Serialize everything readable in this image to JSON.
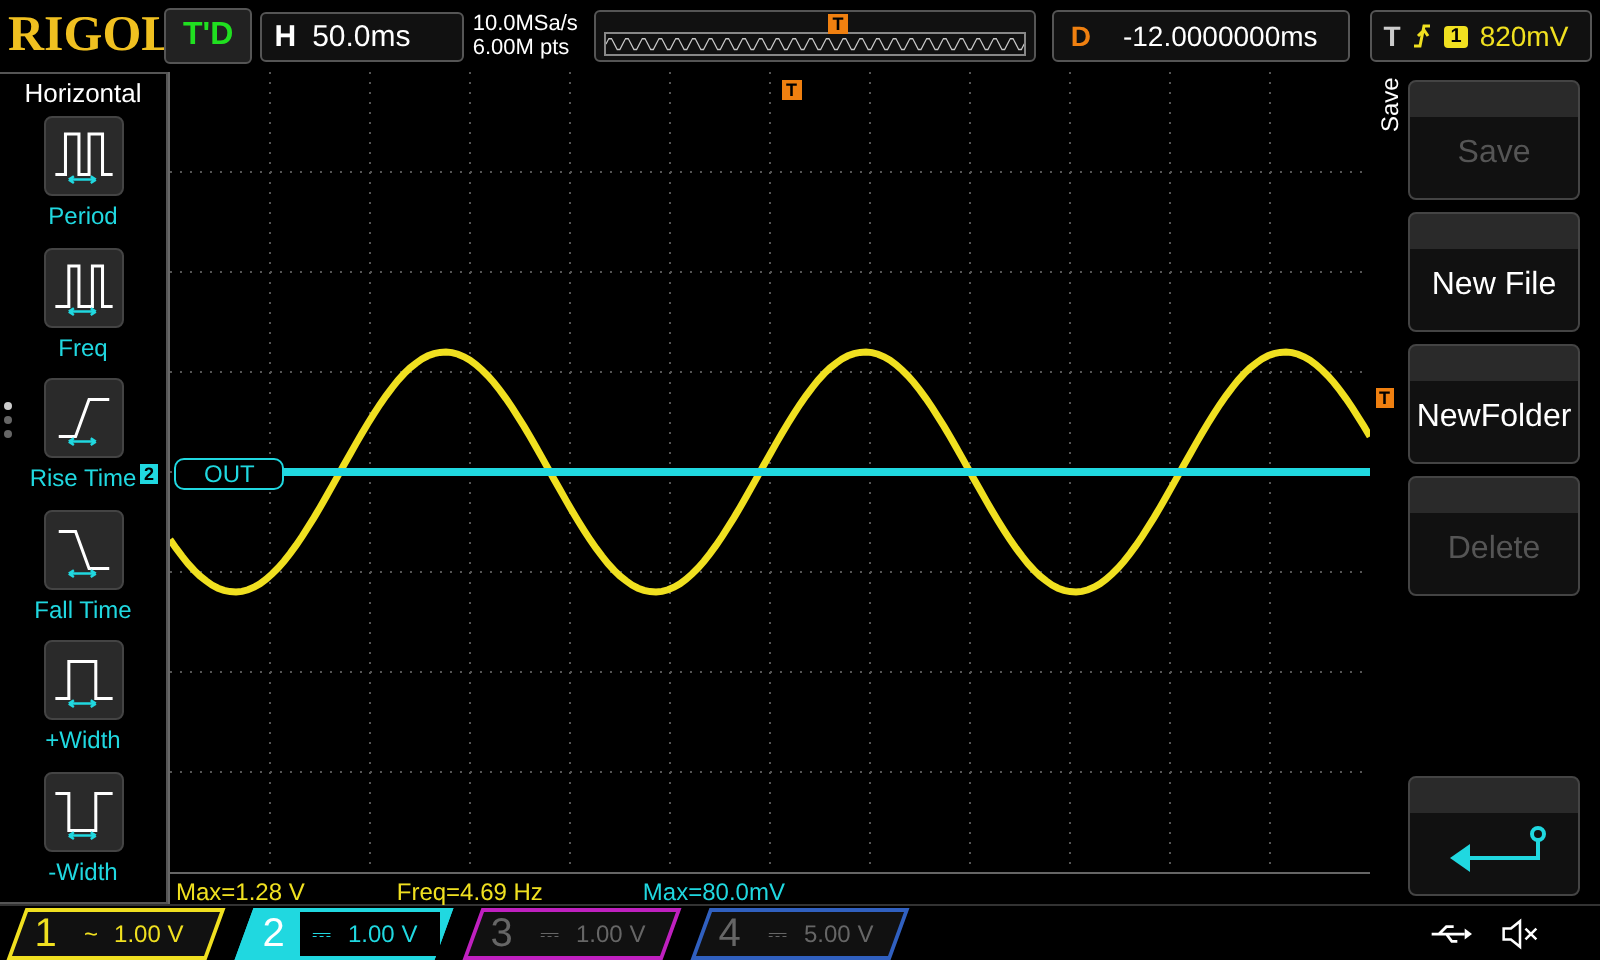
{
  "top_bar": {
    "logo": "RIGOL",
    "run_status": "T'D",
    "horizontal": {
      "label": "H",
      "timebase": "50.0ms",
      "sample_rate": "10.0MSa/s",
      "memory_depth": "6.00M pts",
      "trigger_marker": "T"
    },
    "delay": {
      "label": "D",
      "value": "-12.0000000ms"
    },
    "trigger": {
      "label": "T",
      "source": "1",
      "level": "820mV"
    }
  },
  "left_menu": {
    "title": "Horizontal",
    "items": [
      {
        "kind": "period",
        "label": "Period"
      },
      {
        "kind": "freq",
        "label": "Freq"
      },
      {
        "kind": "rise",
        "label": "Rise Time"
      },
      {
        "kind": "fall",
        "label": "Fall Time"
      },
      {
        "kind": "pwidth",
        "label": "+Width"
      },
      {
        "kind": "nwidth",
        "label": "-Width"
      }
    ]
  },
  "screen": {
    "trigger_position_marker": "T",
    "trigger_level_marker": "T",
    "channel_marker": "2",
    "channel_label": "OUT"
  },
  "right_menu": {
    "title": "Save",
    "buttons": [
      {
        "kind": "text",
        "label": "Save",
        "disabled": true
      },
      {
        "kind": "text",
        "label": "New File",
        "disabled": false
      },
      {
        "kind": "text",
        "label": "NewFolder",
        "disabled": false
      },
      {
        "kind": "text",
        "label": "Delete",
        "disabled": true
      },
      {
        "kind": "back"
      }
    ]
  },
  "measurements": [
    {
      "text": "Max=1.28 V",
      "color": "#f0e020"
    },
    {
      "text": "Freq=4.69 Hz",
      "color": "#f0e020"
    },
    {
      "text": "Max=80.0mV",
      "color": "#20d8e0"
    }
  ],
  "channels": [
    {
      "number": "1",
      "coupling": "~",
      "scale": "1.00 V",
      "on": true,
      "selected": false,
      "color": "#f0e020"
    },
    {
      "number": "2",
      "coupling": "⎓",
      "scale": "1.00 V",
      "on": true,
      "selected": true,
      "color": "#20d8e0"
    },
    {
      "number": "3",
      "coupling": "⎓",
      "scale": "1.00 V",
      "on": false,
      "selected": false,
      "color": "#c020c0"
    },
    {
      "number": "4",
      "coupling": "⎓",
      "scale": "5.00 V",
      "on": false,
      "selected": false,
      "color": "#3060c0"
    }
  ]
}
